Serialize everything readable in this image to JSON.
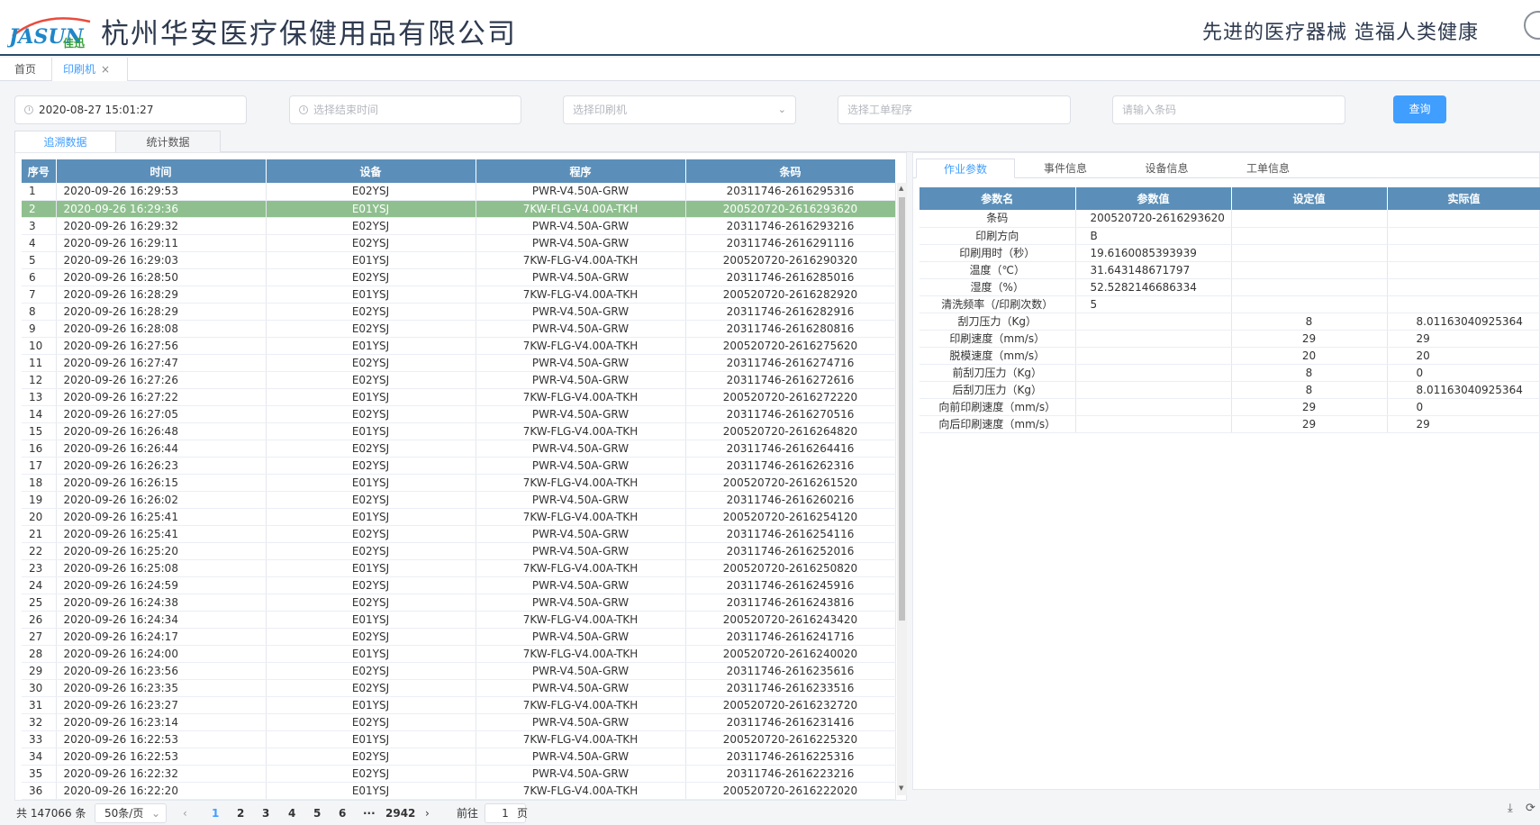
{
  "header": {
    "logo_text": "JASUN佳迅",
    "company": "杭州华安医疗保健用品有限公司",
    "slogan": "先进的医疗器械  造福人类健康"
  },
  "tabs": [
    {
      "label": "首页"
    },
    {
      "label": "印刷机",
      "close": "×"
    }
  ],
  "filters": {
    "start_time": "2020-08-27 15:01:27",
    "end_time_placeholder": "选择结束时间",
    "printer_placeholder": "选择印刷机",
    "program_placeholder": "选择工单程序",
    "barcode_placeholder": "请输入条码",
    "query_label": "查询"
  },
  "subtabs": [
    "追溯数据",
    "统计数据"
  ],
  "left_table": {
    "columns": [
      "序号",
      "时间",
      "设备",
      "程序",
      "条码"
    ],
    "selected_index": 1,
    "rows": [
      [
        "1",
        "2020-09-26 16:29:53",
        "E02YSJ",
        "PWR-V4.50A-GRW",
        "20311746-2616295316"
      ],
      [
        "2",
        "2020-09-26 16:29:36",
        "E01YSJ",
        "7KW-FLG-V4.00A-TKH",
        "200520720-2616293620"
      ],
      [
        "3",
        "2020-09-26 16:29:32",
        "E02YSJ",
        "PWR-V4.50A-GRW",
        "20311746-2616293216"
      ],
      [
        "4",
        "2020-09-26 16:29:11",
        "E02YSJ",
        "PWR-V4.50A-GRW",
        "20311746-2616291116"
      ],
      [
        "5",
        "2020-09-26 16:29:03",
        "E01YSJ",
        "7KW-FLG-V4.00A-TKH",
        "200520720-2616290320"
      ],
      [
        "6",
        "2020-09-26 16:28:50",
        "E02YSJ",
        "PWR-V4.50A-GRW",
        "20311746-2616285016"
      ],
      [
        "7",
        "2020-09-26 16:28:29",
        "E01YSJ",
        "7KW-FLG-V4.00A-TKH",
        "200520720-2616282920"
      ],
      [
        "8",
        "2020-09-26 16:28:29",
        "E02YSJ",
        "PWR-V4.50A-GRW",
        "20311746-2616282916"
      ],
      [
        "9",
        "2020-09-26 16:28:08",
        "E02YSJ",
        "PWR-V4.50A-GRW",
        "20311746-2616280816"
      ],
      [
        "10",
        "2020-09-26 16:27:56",
        "E01YSJ",
        "7KW-FLG-V4.00A-TKH",
        "200520720-2616275620"
      ],
      [
        "11",
        "2020-09-26 16:27:47",
        "E02YSJ",
        "PWR-V4.50A-GRW",
        "20311746-2616274716"
      ],
      [
        "12",
        "2020-09-26 16:27:26",
        "E02YSJ",
        "PWR-V4.50A-GRW",
        "20311746-2616272616"
      ],
      [
        "13",
        "2020-09-26 16:27:22",
        "E01YSJ",
        "7KW-FLG-V4.00A-TKH",
        "200520720-2616272220"
      ],
      [
        "14",
        "2020-09-26 16:27:05",
        "E02YSJ",
        "PWR-V4.50A-GRW",
        "20311746-2616270516"
      ],
      [
        "15",
        "2020-09-26 16:26:48",
        "E01YSJ",
        "7KW-FLG-V4.00A-TKH",
        "200520720-2616264820"
      ],
      [
        "16",
        "2020-09-26 16:26:44",
        "E02YSJ",
        "PWR-V4.50A-GRW",
        "20311746-2616264416"
      ],
      [
        "17",
        "2020-09-26 16:26:23",
        "E02YSJ",
        "PWR-V4.50A-GRW",
        "20311746-2616262316"
      ],
      [
        "18",
        "2020-09-26 16:26:15",
        "E01YSJ",
        "7KW-FLG-V4.00A-TKH",
        "200520720-2616261520"
      ],
      [
        "19",
        "2020-09-26 16:26:02",
        "E02YSJ",
        "PWR-V4.50A-GRW",
        "20311746-2616260216"
      ],
      [
        "20",
        "2020-09-26 16:25:41",
        "E01YSJ",
        "7KW-FLG-V4.00A-TKH",
        "200520720-2616254120"
      ],
      [
        "21",
        "2020-09-26 16:25:41",
        "E02YSJ",
        "PWR-V4.50A-GRW",
        "20311746-2616254116"
      ],
      [
        "22",
        "2020-09-26 16:25:20",
        "E02YSJ",
        "PWR-V4.50A-GRW",
        "20311746-2616252016"
      ],
      [
        "23",
        "2020-09-26 16:25:08",
        "E01YSJ",
        "7KW-FLG-V4.00A-TKH",
        "200520720-2616250820"
      ],
      [
        "24",
        "2020-09-26 16:24:59",
        "E02YSJ",
        "PWR-V4.50A-GRW",
        "20311746-2616245916"
      ],
      [
        "25",
        "2020-09-26 16:24:38",
        "E02YSJ",
        "PWR-V4.50A-GRW",
        "20311746-2616243816"
      ],
      [
        "26",
        "2020-09-26 16:24:34",
        "E01YSJ",
        "7KW-FLG-V4.00A-TKH",
        "200520720-2616243420"
      ],
      [
        "27",
        "2020-09-26 16:24:17",
        "E02YSJ",
        "PWR-V4.50A-GRW",
        "20311746-2616241716"
      ],
      [
        "28",
        "2020-09-26 16:24:00",
        "E01YSJ",
        "7KW-FLG-V4.00A-TKH",
        "200520720-2616240020"
      ],
      [
        "29",
        "2020-09-26 16:23:56",
        "E02YSJ",
        "PWR-V4.50A-GRW",
        "20311746-2616235616"
      ],
      [
        "30",
        "2020-09-26 16:23:35",
        "E02YSJ",
        "PWR-V4.50A-GRW",
        "20311746-2616233516"
      ],
      [
        "31",
        "2020-09-26 16:23:27",
        "E01YSJ",
        "7KW-FLG-V4.00A-TKH",
        "200520720-2616232720"
      ],
      [
        "32",
        "2020-09-26 16:23:14",
        "E02YSJ",
        "PWR-V4.50A-GRW",
        "20311746-2616231416"
      ],
      [
        "33",
        "2020-09-26 16:22:53",
        "E01YSJ",
        "7KW-FLG-V4.00A-TKH",
        "200520720-2616225320"
      ],
      [
        "34",
        "2020-09-26 16:22:53",
        "E02YSJ",
        "PWR-V4.50A-GRW",
        "20311746-2616225316"
      ],
      [
        "35",
        "2020-09-26 16:22:32",
        "E02YSJ",
        "PWR-V4.50A-GRW",
        "20311746-2616223216"
      ],
      [
        "36",
        "2020-09-26 16:22:20",
        "E01YSJ",
        "7KW-FLG-V4.00A-TKH",
        "200520720-2616222020"
      ]
    ]
  },
  "pagination": {
    "total": "共 147066 条",
    "page_size": "50条/页",
    "prev": "‹",
    "pages": [
      "1",
      "2",
      "3",
      "4",
      "5",
      "6"
    ],
    "ellipsis": "···",
    "last": "2942",
    "next": "›",
    "goto_label": "前往",
    "goto_value": "1",
    "goto_suffix": "页"
  },
  "right_tabs": [
    "作业参数",
    "事件信息",
    "设备信息",
    "工单信息"
  ],
  "right_table": {
    "columns": [
      "参数名",
      "参数值",
      "设定值",
      "实际值"
    ],
    "rows": [
      [
        "条码",
        "200520720-2616293620",
        "",
        ""
      ],
      [
        "印刷方向",
        "B",
        "",
        ""
      ],
      [
        "印刷用时（秒）",
        "19.6160085393939",
        "",
        ""
      ],
      [
        "温度（℃）",
        "31.643148671797",
        "",
        ""
      ],
      [
        "湿度（%）",
        "52.5282146686334",
        "",
        ""
      ],
      [
        "清洗频率（/印刷次数）",
        "5",
        "",
        ""
      ],
      [
        "刮刀压力（Kg）",
        "",
        "8",
        "8.01163040925364"
      ],
      [
        "印刷速度（mm/s）",
        "",
        "29",
        "29"
      ],
      [
        "脱模速度（mm/s）",
        "",
        "20",
        "20"
      ],
      [
        "前刮刀压力（Kg）",
        "",
        "8",
        "0"
      ],
      [
        "后刮刀压力（Kg）",
        "",
        "8",
        "8.01163040925364"
      ],
      [
        "向前印刷速度（mm/s）",
        "",
        "29",
        "0"
      ],
      [
        "向后印刷速度（mm/s）",
        "",
        "29",
        "29"
      ]
    ]
  },
  "colors": {
    "accent": "#409eff",
    "header_blue": "#5b8fb9",
    "selected_row": "#8fbf8f"
  }
}
